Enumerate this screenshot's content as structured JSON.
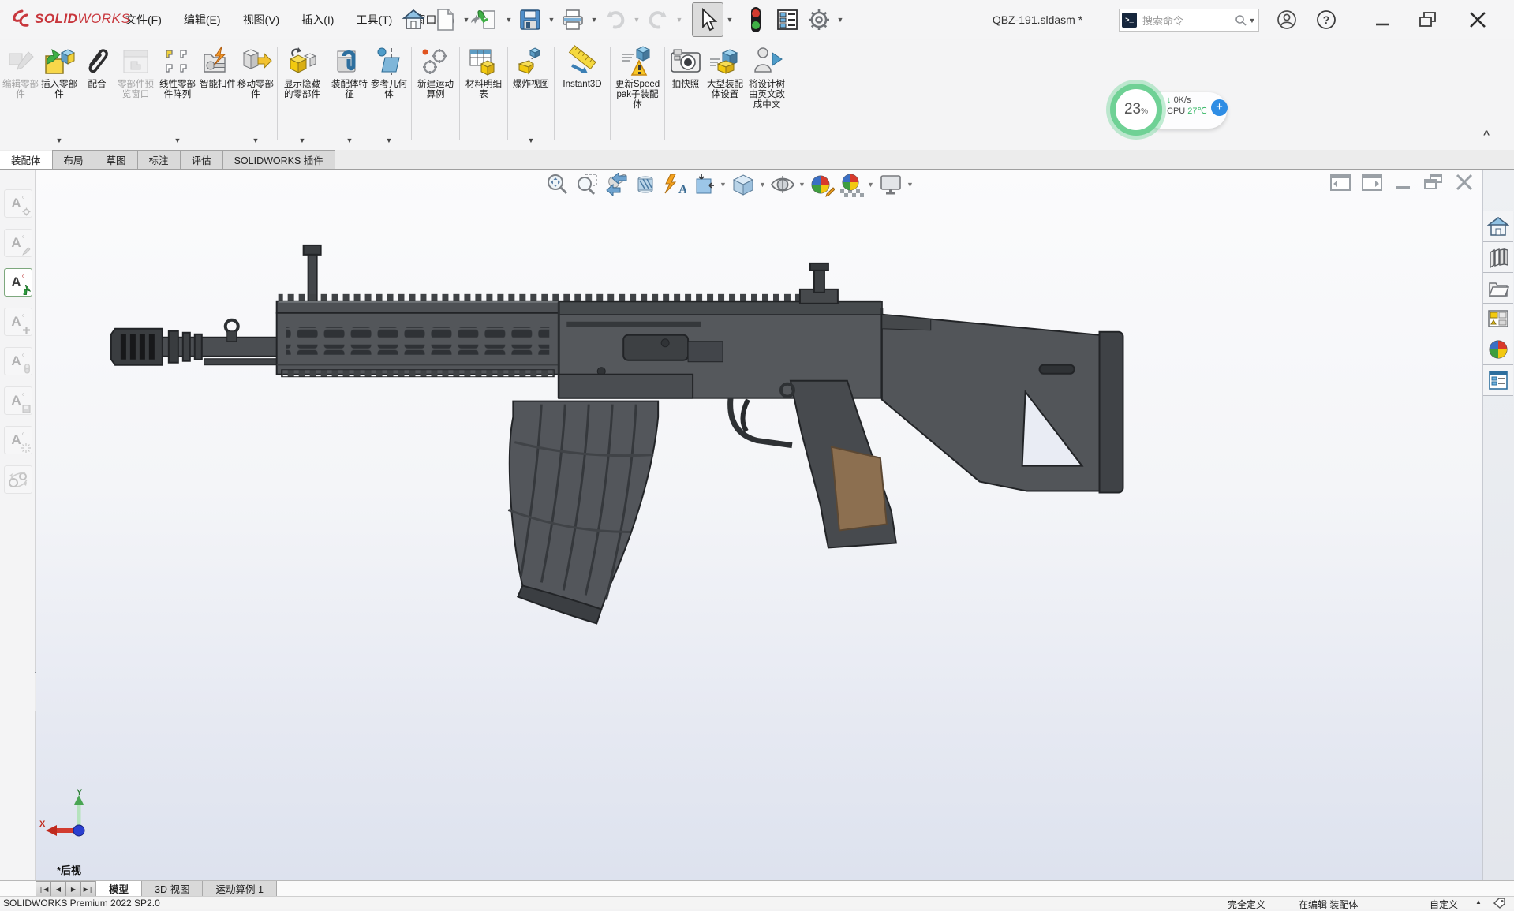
{
  "titlebar": {
    "logo_text_bold": "SOLID",
    "logo_text_light": "WORKS",
    "menus": [
      "文件(F)",
      "编辑(E)",
      "视图(V)",
      "插入(I)",
      "工具(T)",
      "窗口(W)"
    ],
    "document_title": "QBZ-191.sldasm *",
    "search_placeholder": "搜索命令",
    "quick_access_icons": [
      "home",
      "new-document",
      "open-with-dropdown",
      "save-with-dropdown",
      "print-with-dropdown",
      "undo-disabled",
      "redo-disabled",
      "select-cursor-active",
      "rebuild-traffic-light",
      "options-list",
      "settings-gear"
    ]
  },
  "cpu_widget": {
    "percent": "23",
    "percent_unit": "%",
    "down_arrow": "↓",
    "down_speed": "0K/s",
    "cpu_label": "CPU",
    "cpu_temp": "27℃",
    "plus": "+"
  },
  "command_manager": {
    "collapse_chevron": "^",
    "buttons": [
      {
        "label": "编辑零部件",
        "disabled": true,
        "dropdown": false
      },
      {
        "label": "插入零部件",
        "disabled": false,
        "dropdown": true
      },
      {
        "label": "配合",
        "disabled": false,
        "dropdown": false
      },
      {
        "label": "零部件预览窗口",
        "disabled": true,
        "dropdown": false
      },
      {
        "label": "线性零部件阵列",
        "disabled": false,
        "dropdown": true
      },
      {
        "label": "智能扣件",
        "disabled": false,
        "dropdown": false
      },
      {
        "label": "移动零部件",
        "disabled": false,
        "dropdown": true
      },
      {
        "label": "显示隐藏的零部件",
        "disabled": false,
        "dropdown": true
      },
      {
        "label": "装配体特征",
        "disabled": false,
        "dropdown": true
      },
      {
        "label": "参考几何体",
        "disabled": false,
        "dropdown": true
      },
      {
        "label": "新建运动算例",
        "disabled": false,
        "dropdown": false
      },
      {
        "label": "材料明细表",
        "disabled": false,
        "dropdown": false
      },
      {
        "label": "爆炸视图",
        "disabled": false,
        "dropdown": true
      },
      {
        "label": "Instant3D",
        "disabled": false,
        "dropdown": false
      },
      {
        "label": "更新Speedpak子装配体",
        "disabled": false,
        "dropdown": false
      },
      {
        "label": "拍快照",
        "disabled": false,
        "dropdown": false
      },
      {
        "label": "大型装配体设置",
        "disabled": false,
        "dropdown": false
      },
      {
        "label": "将设计树由英文改成中文",
        "disabled": false,
        "dropdown": false
      }
    ]
  },
  "command_tabs": {
    "active": "装配体",
    "items": [
      "布局",
      "草图",
      "标注",
      "评估",
      "SOLIDWORKS 插件"
    ]
  },
  "left_toolbar": {
    "icons": [
      "annotation-gear-macro",
      "annotation-edit-macro",
      "annotation-export-macro-active",
      "annotation-add-macro",
      "annotation-lights-macro",
      "annotation-save-macro",
      "annotation-burst-macro",
      "belt-chain-macro"
    ]
  },
  "headsup_toolbar": {
    "icons": [
      "zoom-fit",
      "zoom-area",
      "previous-view",
      "section-view",
      "hide-annotations",
      "apply-scene-box",
      "view-orientation",
      "display-style",
      "edit-appearance",
      "apply-scene",
      "view-settings"
    ]
  },
  "doc_window_controls": {
    "icons": [
      "expand-left-pane",
      "expand-right-pane",
      "minimize-document",
      "restore-document",
      "close-document"
    ]
  },
  "right_pane": {
    "icons": [
      "home",
      "design-library",
      "file-explorer",
      "view-palette",
      "appearances-scenes",
      "custom-properties"
    ]
  },
  "viewport": {
    "view_label": "*后视",
    "triad_x": "X",
    "triad_y": "Y"
  },
  "doc_tabs": {
    "items": [
      "模型",
      "3D 视图",
      "运动算例 1"
    ],
    "active": "模型"
  },
  "statusbar": {
    "product": "SOLIDWORKS Premium 2022 SP2.0",
    "fully_defined": "完全定义",
    "editing_mode": "在编辑 装配体",
    "custom": "自定义",
    "arrow": "▲"
  }
}
